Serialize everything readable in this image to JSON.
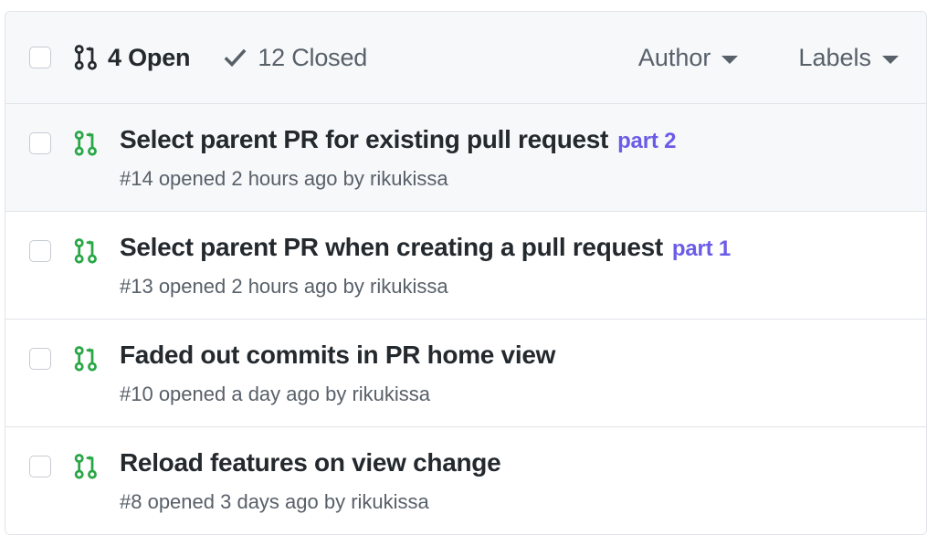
{
  "colors": {
    "open_green": "#28a745",
    "header_bg": "#f6f8fa",
    "border": "#e1e4e8",
    "text_dark": "#24292e",
    "text_muted": "#586069",
    "link_purple": "#6b5ce7"
  },
  "header": {
    "select_all_checkbox": "",
    "states": [
      {
        "icon": "git-pull-request-icon",
        "label": "4 Open",
        "active": true
      },
      {
        "icon": "check-icon",
        "label": "12 Closed",
        "active": false
      }
    ],
    "filters": [
      {
        "label": "Author",
        "icon": "chevron-down-icon"
      },
      {
        "label": "Labels",
        "icon": "chevron-down-icon"
      }
    ]
  },
  "pull_requests": [
    {
      "icon": "git-pull-request-icon",
      "title": "Select parent PR for existing pull request",
      "suffix": "part 2",
      "meta": "#14 opened 2 hours ago by rikukissa",
      "highlighted": true
    },
    {
      "icon": "git-pull-request-icon",
      "title": "Select parent PR when creating a pull request",
      "suffix": "part 1",
      "meta": "#13 opened 2 hours ago by rikukissa",
      "highlighted": false
    },
    {
      "icon": "git-pull-request-icon",
      "title": "Faded out commits in PR home view",
      "suffix": "",
      "meta": "#10 opened a day ago by rikukissa",
      "highlighted": false
    },
    {
      "icon": "git-pull-request-icon",
      "title": "Reload features on view change",
      "suffix": "",
      "meta": "#8 opened 3 days ago by rikukissa",
      "highlighted": false
    }
  ]
}
